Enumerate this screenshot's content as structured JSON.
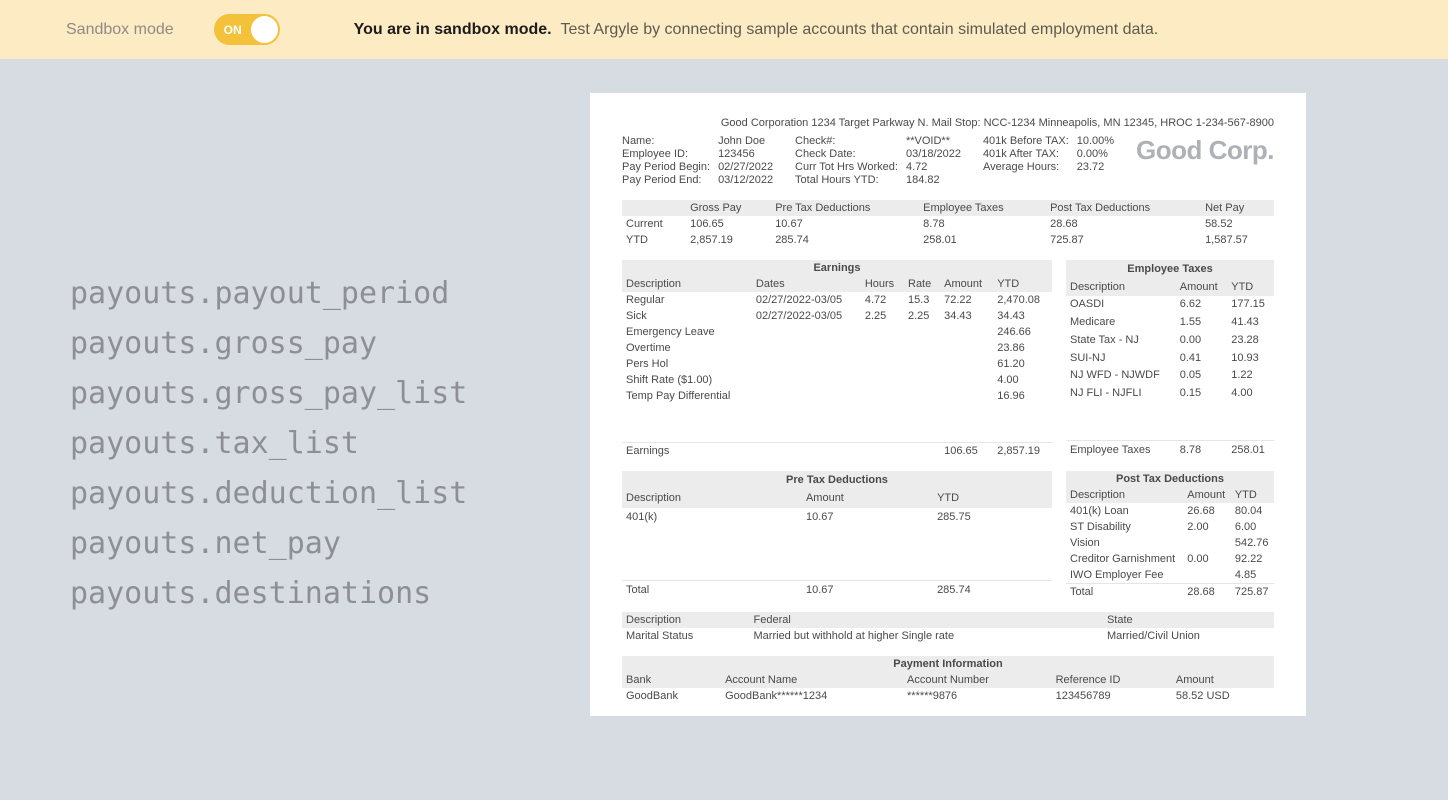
{
  "banner": {
    "label": "Sandbox mode",
    "toggle": "ON",
    "strong": "You are in sandbox mode.",
    "rest": "Test Argyle by connecting sample accounts that contain simulated employment data."
  },
  "fields": [
    "payouts.payout_period",
    "payouts.gross_pay",
    "payouts.gross_pay_list",
    "payouts.tax_list",
    "payouts.deduction_list",
    "payouts.net_pay",
    "payouts.destinations"
  ],
  "corpAddress": "Good Corporation 1234 Target Parkway N. Mail Stop: NCC-1234 Minneapolis, MN 12345, HROC 1-234-567-8900",
  "logo": "Good Corp.",
  "block1": [
    [
      "Name:",
      "John Doe"
    ],
    [
      "Employee ID:",
      "123456"
    ],
    [
      "Pay Period Begin:",
      "02/27/2022"
    ],
    [
      "Pay Period End:",
      "03/12/2022"
    ]
  ],
  "block2": [
    [
      "Check#:",
      "**VOID**"
    ],
    [
      "Check Date:",
      "03/18/2022"
    ],
    [
      "Curr Tot Hrs Worked:",
      "4.72"
    ],
    [
      "Total Hours YTD:",
      "184.82"
    ]
  ],
  "block3": [
    [
      "401k Before TAX:",
      "10.00%"
    ],
    [
      "401k After TAX:",
      "0.00%"
    ],
    [
      "Average Hours:",
      "23.72"
    ]
  ],
  "summary": {
    "headers": [
      "",
      "Gross Pay",
      "Pre Tax Deductions",
      "Employee Taxes",
      "Post Tax Deductions",
      "Net Pay"
    ],
    "rows": [
      [
        "Current",
        "106.65",
        "10.67",
        "8.78",
        "28.68",
        "58.52"
      ],
      [
        "YTD",
        "2,857.19",
        "285.74",
        "258.01",
        "725.87",
        "1,587.57"
      ]
    ]
  },
  "earnings": {
    "title": "Earnings",
    "headers": [
      "Description",
      "Dates",
      "Hours",
      "Rate",
      "Amount",
      "YTD"
    ],
    "rows": [
      [
        "Regular",
        "02/27/2022-03/05",
        "4.72",
        "15.3",
        "72.22",
        "2,470.08"
      ],
      [
        "Sick",
        "02/27/2022-03/05",
        "2.25",
        "2.25",
        "34.43",
        "34.43"
      ],
      [
        "Emergency Leave",
        "",
        "",
        "",
        "",
        "246.66"
      ],
      [
        "Overtime",
        "",
        "",
        "",
        "",
        "23.86"
      ],
      [
        "Pers Hol",
        "",
        "",
        "",
        "",
        "61.20"
      ],
      [
        "Shift Rate ($1.00)",
        "",
        "",
        "",
        "",
        "4.00"
      ],
      [
        "Temp Pay Differential",
        "",
        "",
        "",
        "",
        "16.96"
      ]
    ],
    "total": [
      "Earnings",
      "",
      "",
      "",
      "106.65",
      "2,857.19"
    ]
  },
  "empTaxes": {
    "title": "Employee Taxes",
    "headers": [
      "Description",
      "Amount",
      "YTD"
    ],
    "rows": [
      [
        "OASDI",
        "6.62",
        "177.15"
      ],
      [
        "Medicare",
        "1.55",
        "41.43"
      ],
      [
        "State Tax - NJ",
        "0.00",
        "23.28"
      ],
      [
        "SUI-NJ",
        "0.41",
        "10.93"
      ],
      [
        "NJ WFD - NJWDF",
        "0.05",
        "1.22"
      ],
      [
        "NJ FLI - NJFLI",
        "0.15",
        "4.00"
      ]
    ],
    "total": [
      "Employee Taxes",
      "8.78",
      "258.01"
    ]
  },
  "preTax": {
    "title": "Pre Tax Deductions",
    "headers": [
      "Description",
      "Amount",
      "YTD"
    ],
    "rows": [
      [
        "401(k)",
        "10.67",
        "285.75"
      ]
    ],
    "total": [
      "Total",
      "10.67",
      "285.74"
    ]
  },
  "postTax": {
    "title": "Post Tax Deductions",
    "headers": [
      "Description",
      "Amount",
      "YTD"
    ],
    "rows": [
      [
        "401(k) Loan",
        "26.68",
        "80.04"
      ],
      [
        "ST Disability",
        "2.00",
        "6.00"
      ],
      [
        "Vision",
        "",
        "542.76"
      ],
      [
        "Creditor Garnishment",
        "0.00",
        "92.22"
      ],
      [
        "IWO Employer Fee",
        "",
        "4.85"
      ]
    ],
    "total": [
      "Total",
      "28.68",
      "725.87"
    ]
  },
  "status": {
    "headers": [
      "Description",
      "Federal",
      "State"
    ],
    "rows": [
      [
        "Marital Status",
        "Married but withhold at higher Single rate",
        "Married/Civil Union"
      ]
    ]
  },
  "payment": {
    "title": "Payment Information",
    "headers": [
      "Bank",
      "Account Name",
      "Account Number",
      "Reference ID",
      "Amount"
    ],
    "rows": [
      [
        "GoodBank",
        "GoodBank******1234",
        "******9876",
        "123456789",
        "58.52 USD"
      ]
    ]
  }
}
